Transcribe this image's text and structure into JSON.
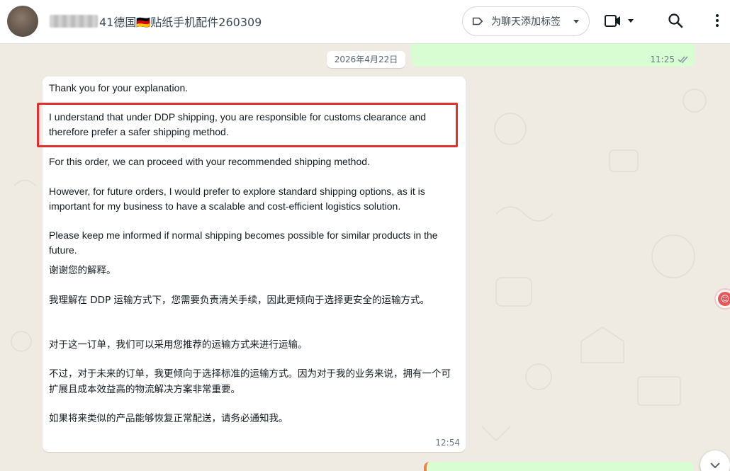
{
  "header": {
    "chat_title_visible": "41德国🇩🇪贴纸手机配件260309",
    "tag_button_label": "为聊天添加标签"
  },
  "chat": {
    "date_pill": "2026年4月22日",
    "outgoing_top": {
      "time": "11:25"
    },
    "incoming_message": {
      "paragraphs_en": [
        "Thank you for your explanation.",
        "I understand that under DDP shipping, you are responsible for customs clearance and therefore prefer a safer shipping method.",
        "For this order, we can proceed with your recommended shipping method.",
        "However, for future orders, I would prefer to explore standard shipping options, as it is important for my business to have a scalable and cost-efficient logistics solution.",
        "Please keep me informed if normal shipping becomes possible for similar products in the future."
      ],
      "paragraphs_zh": [
        "谢谢您的解释。",
        "我理解在 DDP 运输方式下，您需要负责清关手续，因此更倾向于选择更安全的运输方式。",
        "对于这一订单，我们可以采用您推荐的运输方式来进行运输。",
        "不过，对于未来的订单，我更倾向于选择标准的运输方式。因为对于我的业务来说，拥有一个可扩展且成本效益高的物流解决方案非常重要。",
        "如果将来类似的产品能够恢复正常配送，请务必通知我。"
      ],
      "time": "12:54"
    }
  },
  "colors": {
    "highlight": "#e0302f",
    "outgoing_bubble": "#d9fdd3",
    "incoming_bubble": "#ffffff",
    "chat_bg": "#efeae2"
  }
}
